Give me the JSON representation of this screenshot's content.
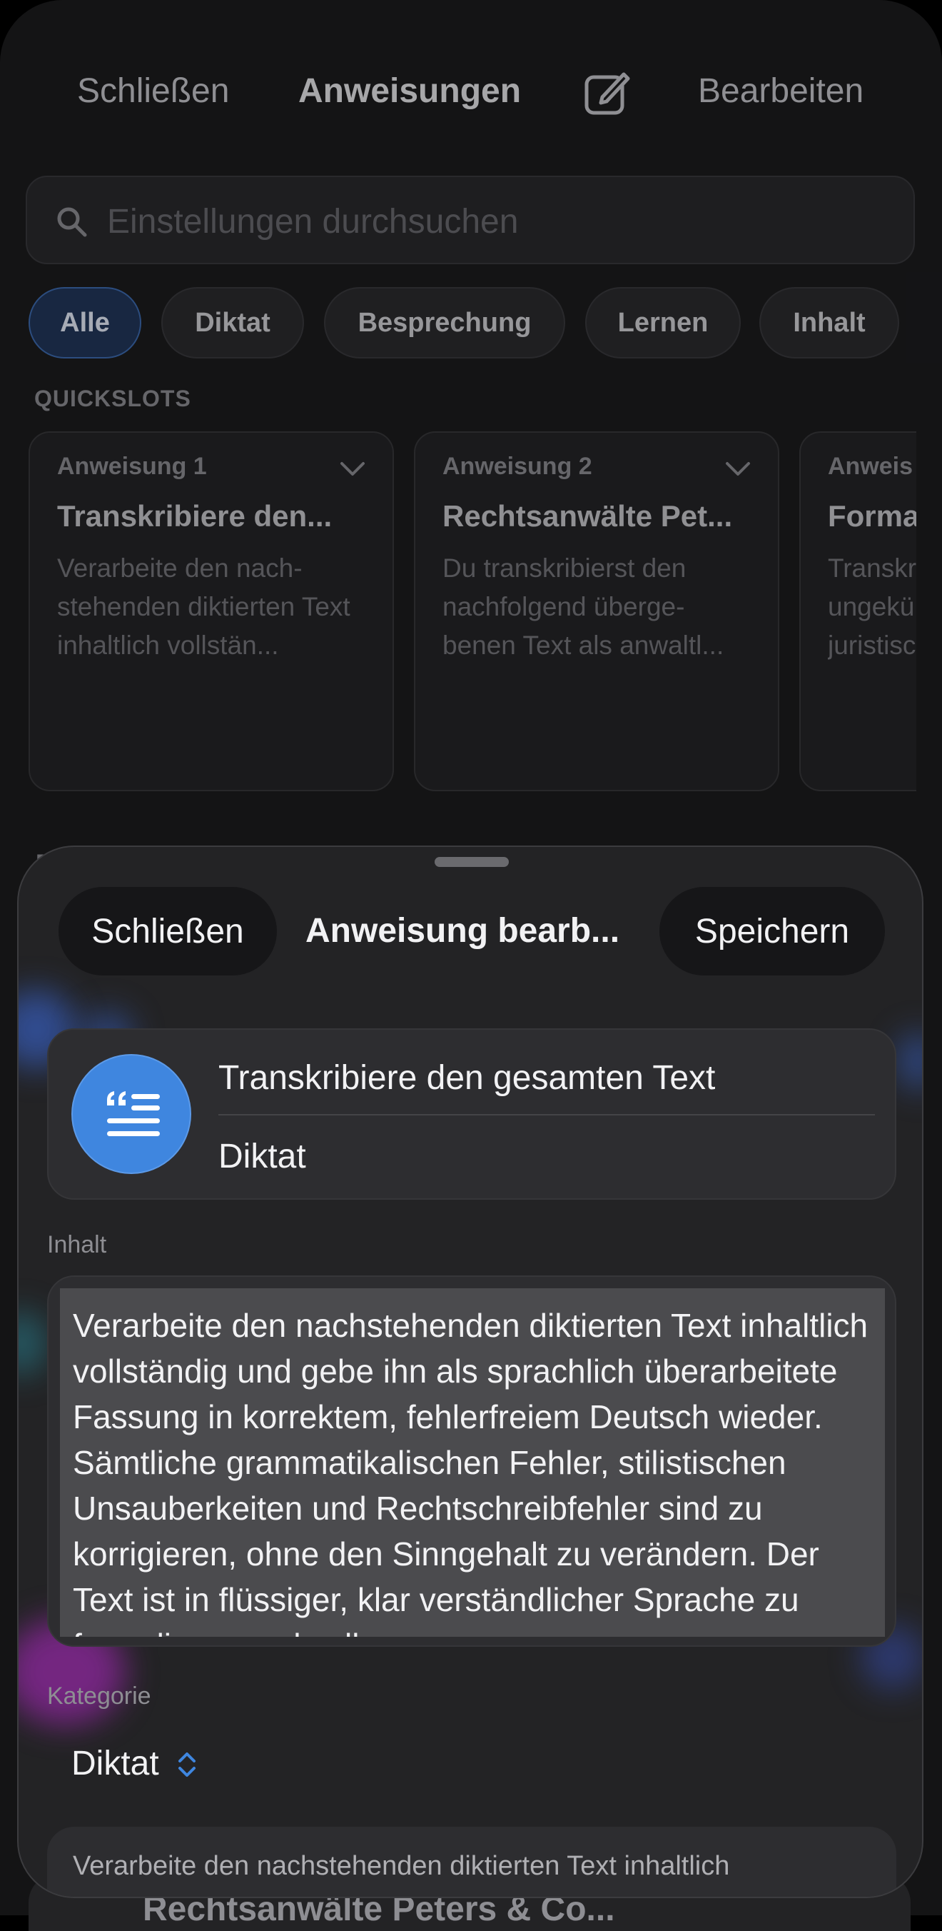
{
  "background": {
    "nav": {
      "close_label": "Schließen",
      "title": "Anweisungen",
      "edit_label": "Bearbeiten"
    },
    "search": {
      "placeholder": "Einstellungen durchsuchen"
    },
    "filters": [
      "Alle",
      "Diktat",
      "Besprechung",
      "Lernen",
      "Inhalt"
    ],
    "active_filter": "Alle",
    "quickslots_label": "QUICKSLOTS",
    "quickslots": [
      {
        "header": "Anweisung 1",
        "title": "Transkribiere den...",
        "description": "Verarbeite den nach-stehenden diktierten Text inhaltlich vollstän..."
      },
      {
        "header": "Anweisung 2",
        "title": "Rechtsanwälte Pet...",
        "description": "Du transkribierst den nachfolgend überge-benen Text als anwaltl..."
      },
      {
        "header": "Anweis",
        "title": "Forma",
        "description": "Transkr ungekü juristisc"
      }
    ],
    "partial_section_letter": "E",
    "bottom_peek_text": "Rechtsanwälte Peters & Co..."
  },
  "sheet": {
    "close_label": "Schließen",
    "title": "Anweisung bearb...",
    "save_label": "Speichern",
    "instruction_name": "Transkribiere den gesamten Text",
    "instruction_category": "Diktat",
    "content_label": "Inhalt",
    "content_text": "Verarbeite den nachstehenden diktierten Text inhaltlich vollständig und gebe ihn als sprachlich überarbeitete Fassung in korrektem, fehlerfreiem Deutsch wieder. Sämtliche grammatikalischen Fehler, stilistischen Unsauberkeiten und Rechtschreibfehler sind zu korrigieren, ohne den Sinngehalt zu verändern. Der Text ist in flüssiger, klar verständlicher Sprache zu formulieren und soll",
    "category_label": "Kategorie",
    "category_value": "Diktat",
    "preview_text": "Verarbeite den nachstehenden diktierten Text inhaltlich"
  },
  "colors": {
    "accent": "#3f86df",
    "background": "#1c1c1e",
    "sheet": "#232325",
    "active_chip": "#22375a"
  },
  "icons": [
    "search-icon",
    "compose-icon",
    "chevron-down-icon",
    "quote-list-icon",
    "up-down-chevron-icon"
  ]
}
